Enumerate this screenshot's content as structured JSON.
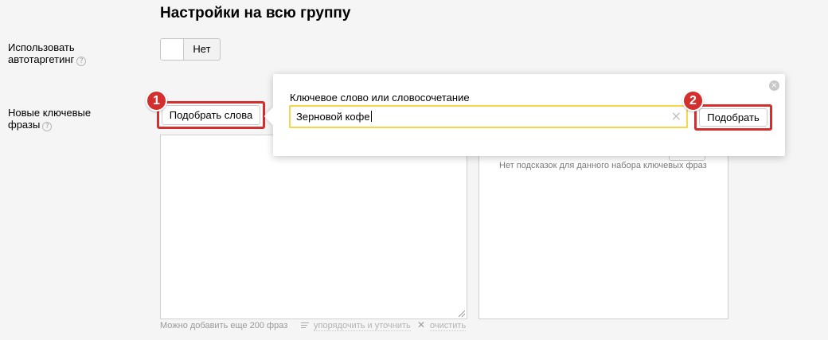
{
  "section": {
    "title": "Настройки на всю группу"
  },
  "autotargeting": {
    "label_line1": "Использовать",
    "label_line2": "автотаргетинг",
    "help": "?",
    "toggle_value": "Нет"
  },
  "keywords": {
    "label_line1": "Новые ключевые",
    "label_line2": "фразы",
    "help": "?",
    "pick_words_label": "Подобрать слова",
    "footer_note": "Можно добавить еще 200 фраз",
    "sort_link": "упорядочить и уточнить",
    "clear_link": "очистить",
    "no_hints": "Нет подсказок для данного набора ключевых фраз"
  },
  "popup": {
    "label": "Ключевое слово или словосочетание",
    "input_value": "Зерновой кофе",
    "clear_glyph": "×",
    "close_glyph": "×",
    "pick_label": "Подобрать"
  },
  "badges": {
    "step1": "1",
    "step2": "2"
  },
  "colors": {
    "highlight": "#d32f2f",
    "input_focus": "#f7d64b"
  }
}
